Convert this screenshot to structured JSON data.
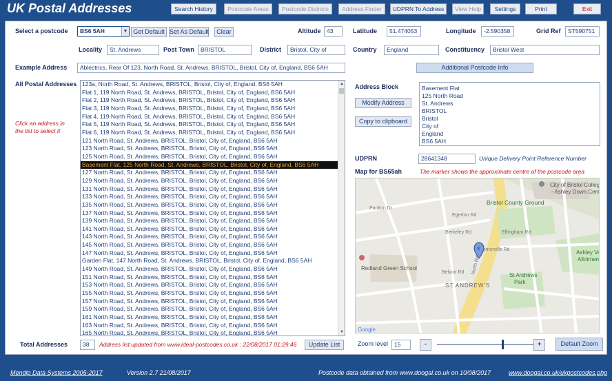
{
  "app_title": "UK Postal Addresses",
  "nav": {
    "search_history": "Search History",
    "postcode_areas": "Postcode Areas",
    "postcode_districts": "Postcode Districts",
    "address_finder": "Address Finder",
    "udprn_to_address": "UDPRN To Address",
    "view_help": "View Help",
    "settings": "Settings",
    "print": "Print",
    "exit": "Exit"
  },
  "form": {
    "select_postcode_label": "Select a postcode",
    "postcode": "BS6 5AH",
    "get_default": "Get Default",
    "set_as_default": "Set As Default",
    "clear": "Clear",
    "altitude_label": "Altitude",
    "altitude": "43",
    "latitude_label": "Latitude",
    "latitude": "51.474053",
    "longitude_label": "Longitude",
    "longitude": "-2.590358",
    "grid_ref_label": "Grid Ref",
    "grid_ref": "ST590751",
    "locality_label": "Locality",
    "locality": "St. Andrews",
    "post_town_label": "Post Town",
    "post_town": "BRISTOL",
    "district_label": "District",
    "district": "Bristol, City of",
    "country_label": "Country",
    "country": "England",
    "constituency_label": "Constituency",
    "constituency": "Bristol West",
    "example_address_label": "Example Address",
    "example_address": "Ablectrics, Rear Of 123, North Road, St. Andrews, BRISTOL, Bristol, City of, England, BS6 5AH",
    "additional_info": "Additional Postcode Info"
  },
  "list": {
    "label": "All Postal Addresses",
    "click_hint": "Click an address in the list to select it",
    "selected_index": 10,
    "items": [
      "123a, North Road, St. Andrews, BRISTOL, Bristol, City of, England, BS6 5AH",
      "Flat 1, 119 North Road, St. Andrews, BRISTOL, Bristol, City of, England, BS6 5AH",
      "Flat 2, 119 North Road, St. Andrews, BRISTOL, Bristol, City of, England, BS6 5AH",
      "Flat 3, 119 North Road, St. Andrews, BRISTOL, Bristol, City of, England, BS6 5AH",
      "Flat 4, 119 North Road, St. Andrews, BRISTOL, Bristol, City of, England, BS6 5AH",
      "Flat 5, 119 North Road, St. Andrews, BRISTOL, Bristol, City of, England, BS6 5AH",
      "Flat 6, 119 North Road, St. Andrews, BRISTOL, Bristol, City of, England, BS6 5AH",
      "121 North Road, St. Andrews, BRISTOL, Bristol, City of, England, BS6 5AH",
      "123 North Road, St. Andrews, BRISTOL, Bristol, City of, England, BS6 5AH",
      "125 North Road, St. Andrews, BRISTOL, Bristol, City of, England, BS6 5AH",
      "Basement Flat, 125 North Road, St. Andrews, BRISTOL, Bristol, City of, England, BS6 5AH",
      "127 North Road, St. Andrews, BRISTOL, Bristol, City of, England, BS6 5AH",
      "129 North Road, St. Andrews, BRISTOL, Bristol, City of, England, BS6 5AH",
      "131 North Road, St. Andrews, BRISTOL, Bristol, City of, England, BS6 5AH",
      "133 North Road, St. Andrews, BRISTOL, Bristol, City of, England, BS6 5AH",
      "135 North Road, St. Andrews, BRISTOL, Bristol, City of, England, BS6 5AH",
      "137 North Road, St. Andrews, BRISTOL, Bristol, City of, England, BS6 5AH",
      "139 North Road, St. Andrews, BRISTOL, Bristol, City of, England, BS6 5AH",
      "141 North Road, St. Andrews, BRISTOL, Bristol, City of, England, BS6 5AH",
      "143 North Road, St. Andrews, BRISTOL, Bristol, City of, England, BS6 5AH",
      "145 North Road, St. Andrews, BRISTOL, Bristol, City of, England, BS6 5AH",
      "147 North Road, St. Andrews, BRISTOL, Bristol, City of, England, BS6 5AH",
      "Garden Flat, 147 North Road, St. Andrews, BRISTOL, Bristol, City of, England, BS6 5AH",
      "149 North Road, St. Andrews, BRISTOL, Bristol, City of, England, BS6 5AH",
      "151 North Road, St. Andrews, BRISTOL, Bristol, City of, England, BS6 5AH",
      "153 North Road, St. Andrews, BRISTOL, Bristol, City of, England, BS6 5AH",
      "155 North Road, St. Andrews, BRISTOL, Bristol, City of, England, BS6 5AH",
      "157 North Road, St. Andrews, BRISTOL, Bristol, City of, England, BS6 5AH",
      "159 North Road, St. Andrews, BRISTOL, Bristol, City of, England, BS6 5AH",
      "161 North Road, St. Andrews, BRISTOL, Bristol, City of, England, BS6 5AH",
      "163 North Road, St. Andrews, BRISTOL, Bristol, City of, England, BS6 5AH",
      "165 North Road, St. Andrews, BRISTOL, Bristol, City of, England, BS6 5AH"
    ],
    "total_label": "Total Addresses",
    "total": "38",
    "update_note": "Address list updated from www.ideal-postcodes.co.uk : 22/08/2017 01:29:46",
    "update_list": "Update List"
  },
  "address_block": {
    "label": "Address Block",
    "modify": "Modify Address",
    "copy": "Copy to clipboard",
    "lines": [
      "Basement Flat",
      "125 North Road",
      "St. Andrews",
      "BRISTOL",
      "Bristol",
      "City of",
      "England",
      "BS6 5AH"
    ]
  },
  "udprn": {
    "label": "UDPRN",
    "value": "28641348",
    "note": "Unique Delivery Point Reference Number"
  },
  "map": {
    "label": "Map for BS65ah",
    "note": "The marker shows the approximate centre of the postcode area",
    "labels": {
      "college": "City of Bristol College",
      "college2": "- Ashley Down Centre",
      "ground": "Bristol County Ground",
      "school": "Redland Green School",
      "st_andrews": "ST ANDREW'S",
      "park": "St Andrews",
      "park2": "Park",
      "allotments": "Ashley Vale",
      "allotments2": "Allotments",
      "north_rd": "North Rd",
      "egerton": "Egerton Rd",
      "berkeley": "Berkeley Rd",
      "somerville": "Somerville Rd",
      "effingham": "Effingham Rd",
      "belvoir": "Belvoir Rd",
      "paulton": "Paulton Dr",
      "google": "Google",
      "marker_letter": "X"
    },
    "zoom_label": "Zoom level",
    "zoom": "15",
    "zoom_out": "-",
    "zoom_in": "+",
    "default_zoom": "Default Zoom"
  },
  "footer": {
    "company": "Mendip Data Systems 2005-2017",
    "version": "Version 2.7   21/08/2017",
    "source": "Postcode data obtained from www.doogal.co.uk on 10/08/2017",
    "link": "www.doogal.co.uk/ukpostcodes.php"
  },
  "colors": {
    "brand": "#1f4e8c",
    "selected_bg": "#111111",
    "selected_fg": "#e6a23c",
    "note_red": "#c01818"
  }
}
